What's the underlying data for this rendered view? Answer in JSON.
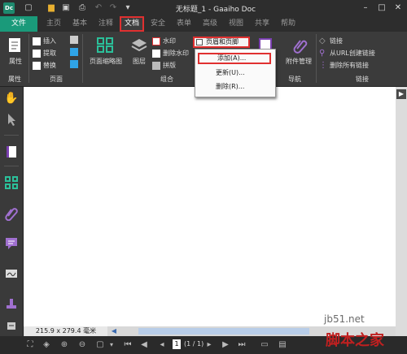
{
  "app": {
    "icon_text": "Dc",
    "title": "无标题_1 - Gaaiho Doc"
  },
  "window_controls": {
    "minimize": "–",
    "maximize": "□",
    "close": "✕"
  },
  "tabs": [
    "文件",
    "主页",
    "基本",
    "注释",
    "文档",
    "安全",
    "表单",
    "高级",
    "视图",
    "共享",
    "帮助"
  ],
  "active_tab": "文档",
  "ribbon": {
    "attributes": {
      "button": "属性",
      "group": "属性"
    },
    "page": {
      "insert": "插入",
      "extract": "提取",
      "replace": "替换",
      "group": "页面"
    },
    "combine": {
      "thumbnail": "页面缩略图",
      "layers": "图层",
      "watermark": "水印",
      "delete_watermark": "删除水印",
      "layout": "拼版",
      "header_footer": "页眉和页脚",
      "group": "组合"
    },
    "nav": {
      "attachments": "附件管理",
      "group": "导航"
    },
    "links": {
      "link": "链接",
      "create_from_url": "从URL创建链接",
      "delete_all": "删除所有链接",
      "group": "链接"
    }
  },
  "dropdown": {
    "add": "添加(A)...",
    "update": "更新(U)...",
    "delete": "删除(R)..."
  },
  "status": {
    "page_size": "215.9 x 279.4 毫米",
    "page_current": "1",
    "page_total": "(1 / 1)"
  },
  "colors": {
    "accent": "#1a9a7a",
    "highlight_red": "#e03030"
  },
  "watermark": {
    "line1": "jb51.net",
    "line2": "脚本之家"
  }
}
